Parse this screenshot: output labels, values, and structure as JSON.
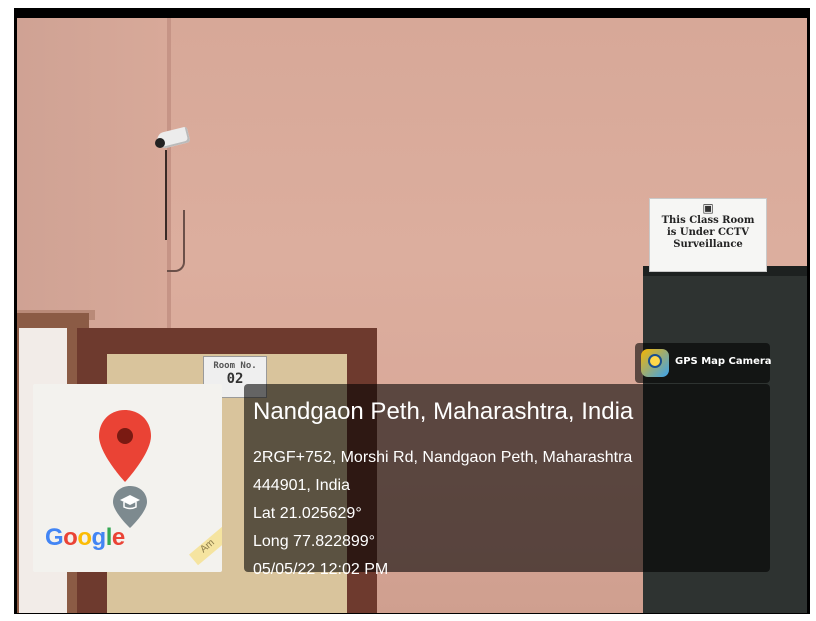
{
  "photo": {
    "room_sign_title": "Room No.",
    "room_sign_number": "02",
    "cctv_sign_lines": [
      "This Class Room",
      "is Under CCTV",
      "Surveillance"
    ]
  },
  "gps_badge": {
    "app_name": "GPS Map Camera",
    "icon": "gps-map-camera-icon"
  },
  "map": {
    "logo_text": "Google",
    "road_label": "Am",
    "pin_icon": "map-pin-icon",
    "school_icon": "school-icon",
    "pin_color": "#EA4335"
  },
  "location": {
    "title": "Nandgaon Peth, Maharashtra, India",
    "address_line1": "2RGF+752, Morshi Rd, Nandgaon Peth, Maharashtra",
    "address_line2": "444901, India",
    "latitude": "Lat 21.025629°",
    "longitude": "Long 77.822899°",
    "datetime": "05/05/22 12:02 PM"
  }
}
